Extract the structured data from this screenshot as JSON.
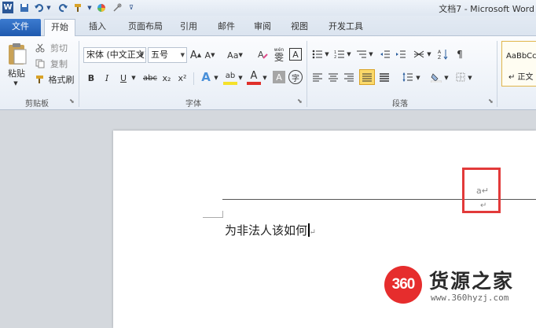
{
  "window": {
    "title": "文档7 - Microsoft Word"
  },
  "quick_access": {
    "word_icon": "W"
  },
  "tabs": [
    {
      "label": "文件"
    },
    {
      "label": "开始"
    },
    {
      "label": "插入"
    },
    {
      "label": "页面布局"
    },
    {
      "label": "引用"
    },
    {
      "label": "邮件"
    },
    {
      "label": "审阅"
    },
    {
      "label": "视图"
    },
    {
      "label": "开发工具"
    }
  ],
  "clipboard": {
    "paste": "粘贴",
    "cut": "剪切",
    "copy": "复制",
    "format_painter": "格式刷",
    "group_label": "剪贴板"
  },
  "font": {
    "font_name": "宋体 (中文正文)",
    "font_size": "五号",
    "grow": "A",
    "shrink": "A",
    "change_case": "Aa",
    "phonetic": "wén",
    "phonetic_char": "雯",
    "border_char": "A",
    "bold": "B",
    "italic": "I",
    "underline": "U",
    "strike": "abc",
    "subscript": "x₂",
    "superscript": "x²",
    "text_effect": "A",
    "highlight": "ab",
    "font_color": "A",
    "char_shading": "A",
    "enclose": "字",
    "group_label": "字体"
  },
  "paragraph": {
    "group_label": "段落"
  },
  "styles": {
    "sample": "AaBbCc",
    "normal": "↵ 正文"
  },
  "document": {
    "header_mark": "a↵",
    "header_return": "↵",
    "body_text": "为非法人该如何",
    "paragraph_mark": "↵"
  },
  "watermark": {
    "logo_number": "360",
    "name": "货源之家",
    "url": "www.360hyzj.com"
  },
  "colors": {
    "file_tab": "#2a66bf",
    "red_highlight": "#e23a3a",
    "watermark_red": "#e62d2d"
  }
}
